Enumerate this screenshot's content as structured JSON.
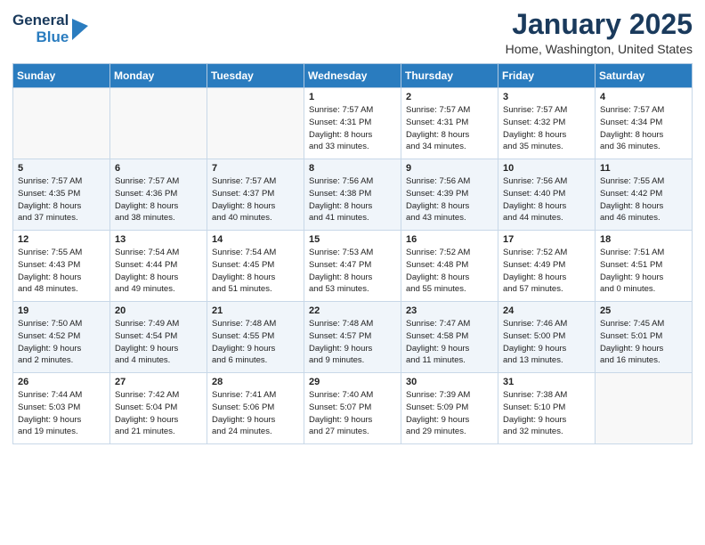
{
  "header": {
    "logo_general": "General",
    "logo_blue": "Blue",
    "month_title": "January 2025",
    "location": "Home, Washington, United States"
  },
  "weekdays": [
    "Sunday",
    "Monday",
    "Tuesday",
    "Wednesday",
    "Thursday",
    "Friday",
    "Saturday"
  ],
  "weeks": [
    [
      {
        "day": "",
        "info": ""
      },
      {
        "day": "",
        "info": ""
      },
      {
        "day": "",
        "info": ""
      },
      {
        "day": "1",
        "info": "Sunrise: 7:57 AM\nSunset: 4:31 PM\nDaylight: 8 hours\nand 33 minutes."
      },
      {
        "day": "2",
        "info": "Sunrise: 7:57 AM\nSunset: 4:31 PM\nDaylight: 8 hours\nand 34 minutes."
      },
      {
        "day": "3",
        "info": "Sunrise: 7:57 AM\nSunset: 4:32 PM\nDaylight: 8 hours\nand 35 minutes."
      },
      {
        "day": "4",
        "info": "Sunrise: 7:57 AM\nSunset: 4:34 PM\nDaylight: 8 hours\nand 36 minutes."
      }
    ],
    [
      {
        "day": "5",
        "info": "Sunrise: 7:57 AM\nSunset: 4:35 PM\nDaylight: 8 hours\nand 37 minutes."
      },
      {
        "day": "6",
        "info": "Sunrise: 7:57 AM\nSunset: 4:36 PM\nDaylight: 8 hours\nand 38 minutes."
      },
      {
        "day": "7",
        "info": "Sunrise: 7:57 AM\nSunset: 4:37 PM\nDaylight: 8 hours\nand 40 minutes."
      },
      {
        "day": "8",
        "info": "Sunrise: 7:56 AM\nSunset: 4:38 PM\nDaylight: 8 hours\nand 41 minutes."
      },
      {
        "day": "9",
        "info": "Sunrise: 7:56 AM\nSunset: 4:39 PM\nDaylight: 8 hours\nand 43 minutes."
      },
      {
        "day": "10",
        "info": "Sunrise: 7:56 AM\nSunset: 4:40 PM\nDaylight: 8 hours\nand 44 minutes."
      },
      {
        "day": "11",
        "info": "Sunrise: 7:55 AM\nSunset: 4:42 PM\nDaylight: 8 hours\nand 46 minutes."
      }
    ],
    [
      {
        "day": "12",
        "info": "Sunrise: 7:55 AM\nSunset: 4:43 PM\nDaylight: 8 hours\nand 48 minutes."
      },
      {
        "day": "13",
        "info": "Sunrise: 7:54 AM\nSunset: 4:44 PM\nDaylight: 8 hours\nand 49 minutes."
      },
      {
        "day": "14",
        "info": "Sunrise: 7:54 AM\nSunset: 4:45 PM\nDaylight: 8 hours\nand 51 minutes."
      },
      {
        "day": "15",
        "info": "Sunrise: 7:53 AM\nSunset: 4:47 PM\nDaylight: 8 hours\nand 53 minutes."
      },
      {
        "day": "16",
        "info": "Sunrise: 7:52 AM\nSunset: 4:48 PM\nDaylight: 8 hours\nand 55 minutes."
      },
      {
        "day": "17",
        "info": "Sunrise: 7:52 AM\nSunset: 4:49 PM\nDaylight: 8 hours\nand 57 minutes."
      },
      {
        "day": "18",
        "info": "Sunrise: 7:51 AM\nSunset: 4:51 PM\nDaylight: 9 hours\nand 0 minutes."
      }
    ],
    [
      {
        "day": "19",
        "info": "Sunrise: 7:50 AM\nSunset: 4:52 PM\nDaylight: 9 hours\nand 2 minutes."
      },
      {
        "day": "20",
        "info": "Sunrise: 7:49 AM\nSunset: 4:54 PM\nDaylight: 9 hours\nand 4 minutes."
      },
      {
        "day": "21",
        "info": "Sunrise: 7:48 AM\nSunset: 4:55 PM\nDaylight: 9 hours\nand 6 minutes."
      },
      {
        "day": "22",
        "info": "Sunrise: 7:48 AM\nSunset: 4:57 PM\nDaylight: 9 hours\nand 9 minutes."
      },
      {
        "day": "23",
        "info": "Sunrise: 7:47 AM\nSunset: 4:58 PM\nDaylight: 9 hours\nand 11 minutes."
      },
      {
        "day": "24",
        "info": "Sunrise: 7:46 AM\nSunset: 5:00 PM\nDaylight: 9 hours\nand 13 minutes."
      },
      {
        "day": "25",
        "info": "Sunrise: 7:45 AM\nSunset: 5:01 PM\nDaylight: 9 hours\nand 16 minutes."
      }
    ],
    [
      {
        "day": "26",
        "info": "Sunrise: 7:44 AM\nSunset: 5:03 PM\nDaylight: 9 hours\nand 19 minutes."
      },
      {
        "day": "27",
        "info": "Sunrise: 7:42 AM\nSunset: 5:04 PM\nDaylight: 9 hours\nand 21 minutes."
      },
      {
        "day": "28",
        "info": "Sunrise: 7:41 AM\nSunset: 5:06 PM\nDaylight: 9 hours\nand 24 minutes."
      },
      {
        "day": "29",
        "info": "Sunrise: 7:40 AM\nSunset: 5:07 PM\nDaylight: 9 hours\nand 27 minutes."
      },
      {
        "day": "30",
        "info": "Sunrise: 7:39 AM\nSunset: 5:09 PM\nDaylight: 9 hours\nand 29 minutes."
      },
      {
        "day": "31",
        "info": "Sunrise: 7:38 AM\nSunset: 5:10 PM\nDaylight: 9 hours\nand 32 minutes."
      },
      {
        "day": "",
        "info": ""
      }
    ]
  ]
}
